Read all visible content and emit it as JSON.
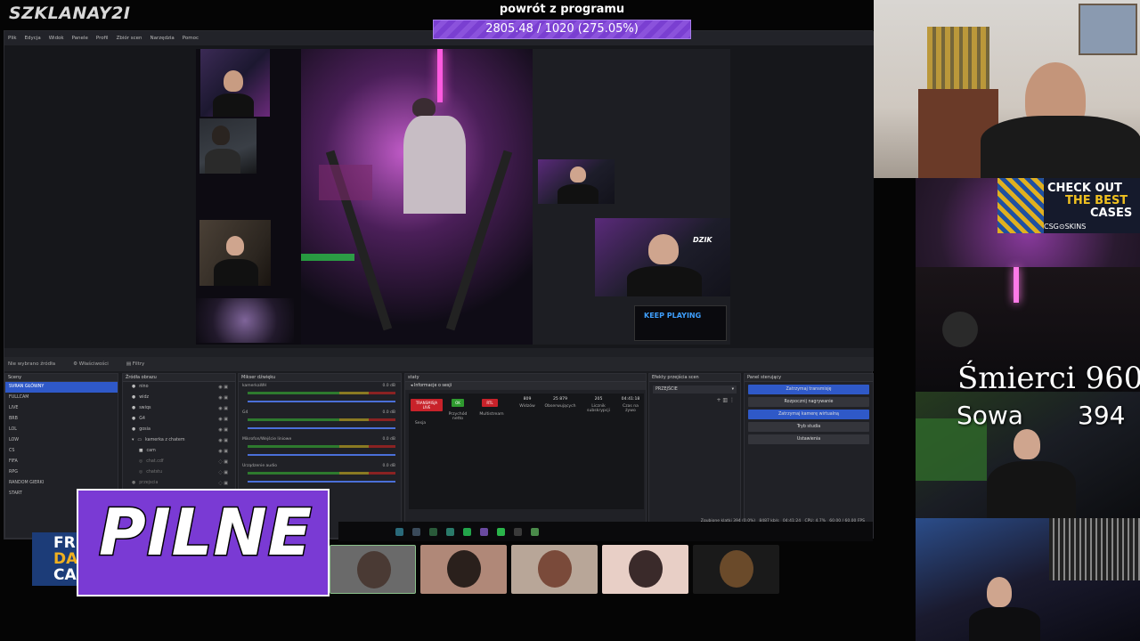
{
  "overlay": {
    "logo": "SZKLANAY2I",
    "goal_title": "powrót z programu",
    "goal_value": "2805.48 / 1020 (275.05%)",
    "goal_progress_percent": 275.05,
    "deaths_label": "Śmierci 960",
    "sowa_label": "Sowa",
    "sowa_value": "394",
    "pilne": "PILNE",
    "badge_lines": [
      "FR",
      "DA",
      "CA"
    ],
    "ad": {
      "line1": "CHECK OUT",
      "line2": "THE BEST",
      "line3": "CASES",
      "brand": "CSG⊙SKINS"
    },
    "preview_keep_playing": "KEEP PLAYING"
  },
  "obs": {
    "menu": [
      "Plik",
      "Edycja",
      "Widok",
      "Panele",
      "Profil",
      "Zbiór scen",
      "Narzędzia",
      "Pomoc"
    ],
    "no_source_selected": "Nie wybrano źródła",
    "properties_button": "Właściwości",
    "filters_button": "Filtry",
    "docks": {
      "scenes": "Sceny",
      "sources": "Źródła obrazu",
      "mixer": "Mikser dźwięku",
      "stats": "staty",
      "transitions": "Efekty przejścia scen",
      "controls": "Panel sterujący"
    },
    "scenes": [
      "SVRAN GŁÓWNY",
      "FULLCAM",
      "LIVE",
      "BRB",
      "LOL",
      "LOW",
      "CS",
      "FIFA",
      "RPG",
      "RANDOM GIERKI",
      "START"
    ],
    "sources": [
      "nino",
      "widz",
      "swiqs",
      "G4",
      "gosia",
      "kamerka z chatem",
      "cam",
      "chat.cdf",
      "chatstu",
      "przejscia"
    ],
    "mixer_channels": [
      {
        "name": "kamerkaWH",
        "db": "0.0 dB"
      },
      {
        "name": "G4",
        "db": "0.0 dB"
      },
      {
        "name": "Mikrofon/Wejście liniowe",
        "db": "0.0 dB"
      },
      {
        "name": "Urządzenie audio",
        "db": "0.0 dB"
      }
    ],
    "stats": {
      "section": "Informacje o sesji",
      "tags": [
        "TRANSMISJA LIVE",
        "OK",
        "RTL"
      ],
      "items": [
        {
          "value": "",
          "label": "Sesja"
        },
        {
          "value": "",
          "label": "Przychód netto"
        },
        {
          "value": "",
          "label": "Multistream"
        },
        {
          "value": "809",
          "label": "Widzów"
        },
        {
          "value": "25 879",
          "label": "Obserwujących"
        },
        {
          "value": "205",
          "label": "Licznik subskrypcji"
        },
        {
          "value": "04:41:18",
          "label": "Czas na żywo"
        }
      ]
    },
    "transition": "PRZEJŚCIE",
    "controls": [
      {
        "label": "Zatrzymaj transmisję",
        "style": "blue"
      },
      {
        "label": "Rozpocznij nagrywanie",
        "style": "gray"
      },
      {
        "label": "Zatrzymaj kamerę wirtualną",
        "style": "blue"
      },
      {
        "label": "Tryb studia",
        "style": "gray"
      },
      {
        "label": "Ustawienia",
        "style": "gray"
      }
    ],
    "status": {
      "dropped": "Zgubione klatki 394 (0.0%)",
      "kbps": "8487 kb/s",
      "time": "04:41:24",
      "cpu": "CPU: 4.7%",
      "fps": "60.00 / 60.00 FPS"
    }
  },
  "colors": {
    "goal_bar": "#7a3fd1",
    "pilne_bg": "#7a3ad4",
    "obs_accent": "#2f59c8"
  }
}
